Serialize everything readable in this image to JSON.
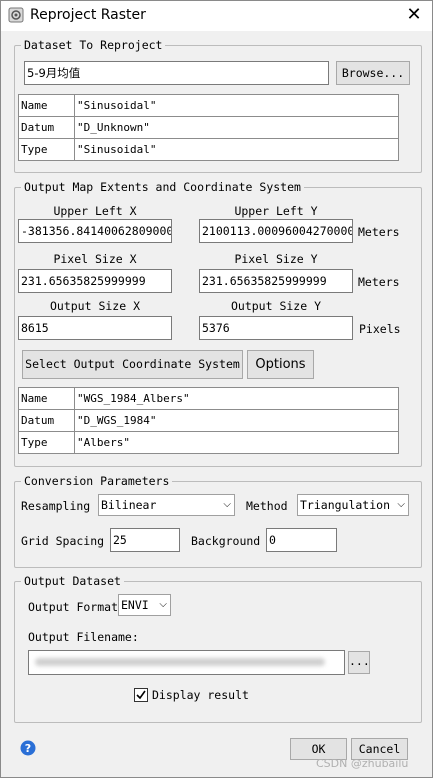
{
  "window": {
    "title": "Reproject Raster"
  },
  "dataset": {
    "group_label": "Dataset To Reproject",
    "name_value": "5-9月均值",
    "browse_label": "Browse...",
    "info": [
      {
        "key": "Name",
        "value": "\"Sinusoidal\""
      },
      {
        "key": "Datum",
        "value": "\"D_Unknown\""
      },
      {
        "key": "Type",
        "value": "\"Sinusoidal\""
      }
    ]
  },
  "extents": {
    "group_label": "Output Map Extents and Coordinate System",
    "upper_left_x_label": "Upper Left X",
    "upper_left_x": "-381356.84140062809000",
    "upper_left_y_label": "Upper Left Y",
    "upper_left_y": "2100113.00096004270000",
    "unit_1": "Meters",
    "pixel_size_x_label": "Pixel Size X",
    "pixel_size_x": "231.65635825999999",
    "pixel_size_y_label": "Pixel Size Y",
    "pixel_size_y": "231.65635825999999",
    "unit_2": "Meters",
    "output_size_x_label": "Output Size X",
    "output_size_x": "8615",
    "output_size_y_label": "Output Size Y",
    "output_size_y": "5376",
    "unit_3": "Pixels",
    "select_cs_label": "Select Output Coordinate System",
    "options_label": "Options",
    "info": [
      {
        "key": "Name",
        "value": "\"WGS_1984_Albers\""
      },
      {
        "key": "Datum",
        "value": "\"D_WGS_1984\""
      },
      {
        "key": "Type",
        "value": "\"Albers\""
      }
    ]
  },
  "conversion": {
    "group_label": "Conversion Parameters",
    "resampling_label": "Resampling",
    "resampling_value": "Bilinear",
    "method_label": "Method",
    "method_value": "Triangulation",
    "grid_spacing_label": "Grid Spacing",
    "grid_spacing_value": "25",
    "background_label": "Background",
    "background_value": "0"
  },
  "output": {
    "group_label": "Output Dataset",
    "format_label": "Output Format",
    "format_value": "ENVI",
    "filename_label": "Output Filename:",
    "filename_browse_label": "...",
    "display_result_label": "Display result",
    "display_result_checked": true
  },
  "footer": {
    "ok_label": "OK",
    "cancel_label": "Cancel",
    "watermark": "CSDN @zhubailu"
  },
  "icons": [
    "app-icon",
    "close-icon",
    "help-icon",
    "checkbox-icon",
    "chevron-down-icon"
  ]
}
